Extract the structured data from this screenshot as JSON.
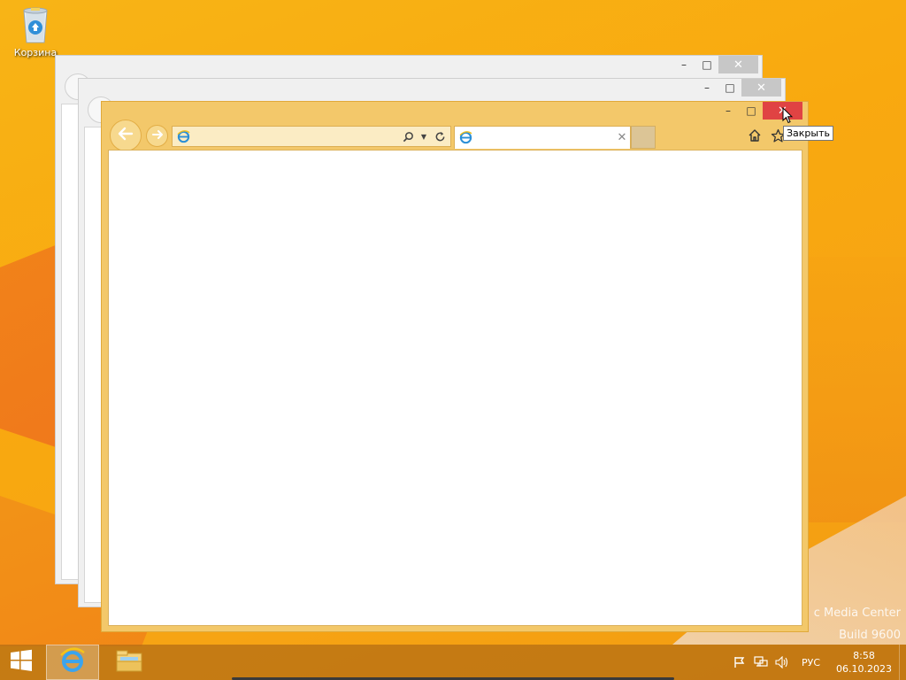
{
  "desktop": {
    "recycle_bin_label": "Корзина",
    "watermark_line1": "c Media Center",
    "watermark_line2": "Build 9600"
  },
  "browser": {
    "address_value": "",
    "tab_title": "",
    "tooltip": "Закрыть",
    "icons": {
      "back": "arrow-left-icon",
      "forward": "arrow-right-icon",
      "search": "search-icon",
      "refresh": "refresh-icon",
      "home": "home-icon",
      "favorites": "star-icon",
      "settings": "gear-icon"
    }
  },
  "window_controls": {
    "minimize": "–",
    "maximize": "□",
    "close": "✕"
  },
  "taskbar": {
    "language": "РУС",
    "time": "8:58",
    "date": "06.10.2023",
    "items": [
      {
        "name": "internet-explorer",
        "active": true
      },
      {
        "name": "file-explorer",
        "active": false
      }
    ]
  },
  "colors": {
    "desktop_bg": "#f8b416",
    "ie_frame": "#f3c86a",
    "close_hover": "#e04343"
  }
}
